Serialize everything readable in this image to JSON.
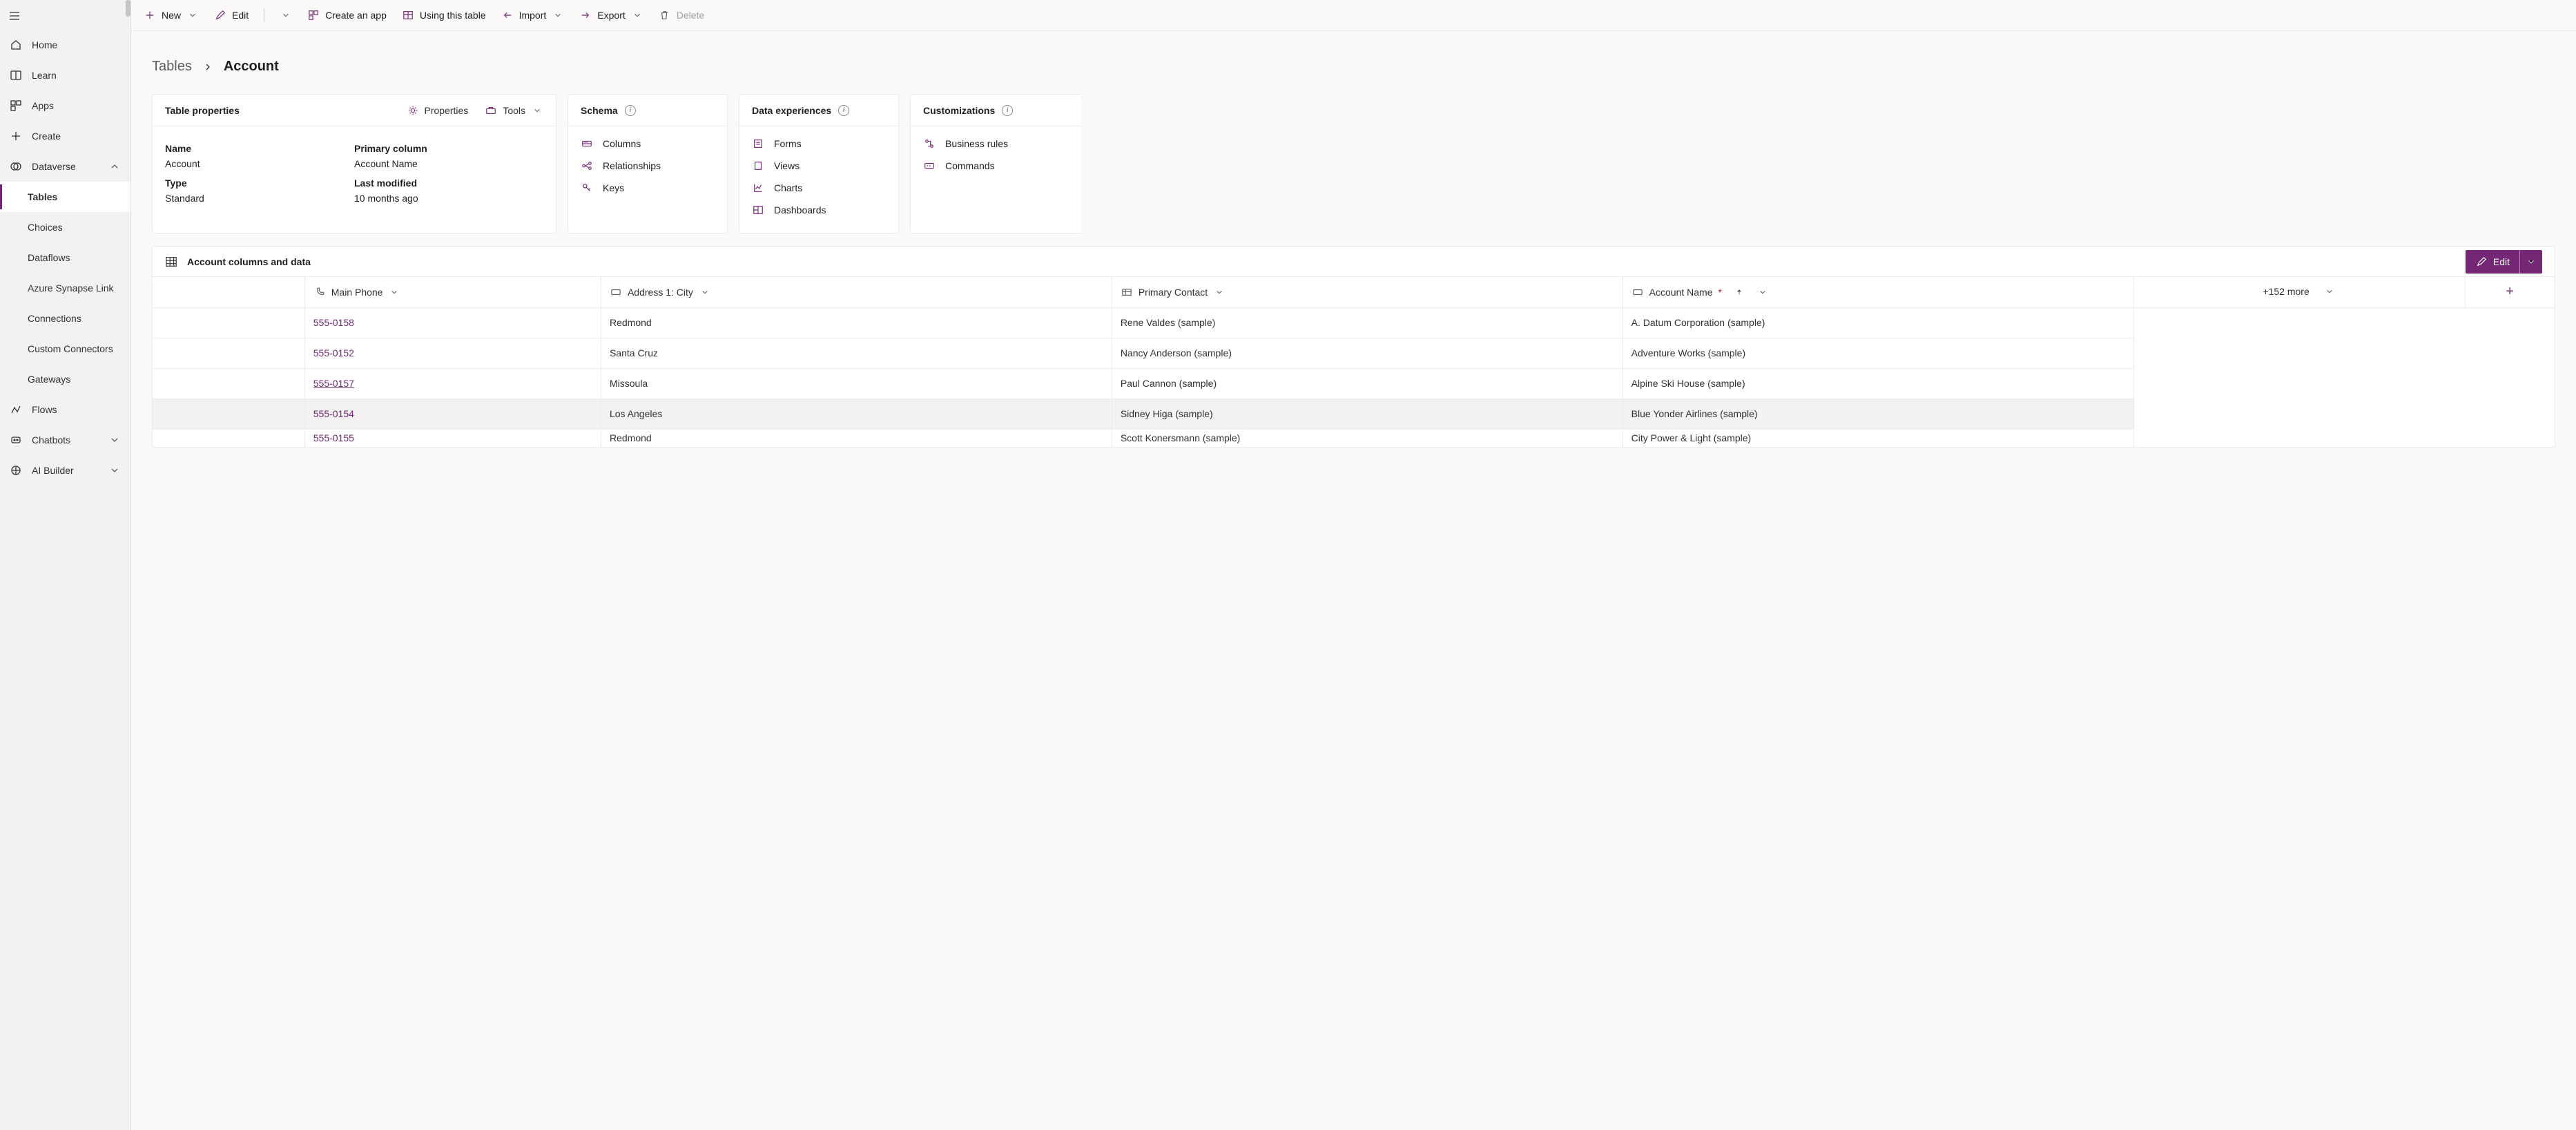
{
  "sidebar": {
    "items": [
      {
        "label": "Home"
      },
      {
        "label": "Learn"
      },
      {
        "label": "Apps"
      },
      {
        "label": "Create"
      },
      {
        "label": "Dataverse"
      }
    ],
    "dataverse_children": [
      {
        "label": "Tables",
        "active": true
      },
      {
        "label": "Choices"
      },
      {
        "label": "Dataflows"
      },
      {
        "label": "Azure Synapse Link"
      },
      {
        "label": "Connections"
      },
      {
        "label": "Custom Connectors"
      },
      {
        "label": "Gateways"
      }
    ],
    "bottom": [
      {
        "label": "Flows"
      },
      {
        "label": "Chatbots"
      },
      {
        "label": "AI Builder"
      }
    ]
  },
  "cmdbar": {
    "new": "New",
    "edit": "Edit",
    "create_app": "Create an app",
    "using_table": "Using this table",
    "import": "Import",
    "export": "Export",
    "delete": "Delete"
  },
  "breadcrumb": {
    "parent": "Tables",
    "current": "Account"
  },
  "table_properties": {
    "title": "Table properties",
    "actions": {
      "properties": "Properties",
      "tools": "Tools"
    },
    "name_label": "Name",
    "name_value": "Account",
    "type_label": "Type",
    "type_value": "Standard",
    "primary_label": "Primary column",
    "primary_value": "Account Name",
    "modified_label": "Last modified",
    "modified_value": "10 months ago"
  },
  "schema": {
    "title": "Schema",
    "items": [
      "Columns",
      "Relationships",
      "Keys"
    ]
  },
  "data_experiences": {
    "title": "Data experiences",
    "items": [
      "Forms",
      "Views",
      "Charts",
      "Dashboards"
    ]
  },
  "customizations": {
    "title": "Customizations",
    "items": [
      "Business rules",
      "Commands"
    ]
  },
  "grid": {
    "title": "Account columns and data",
    "edit": "Edit",
    "more": "+152 more",
    "columns": {
      "phone": "Main Phone",
      "city": "Address 1: City",
      "contact": "Primary Contact",
      "account": "Account Name"
    },
    "rows": [
      {
        "phone": "555-0158",
        "city": "Redmond",
        "contact": "Rene Valdes (sample)",
        "account": "A. Datum Corporation (sample)"
      },
      {
        "phone": "555-0152",
        "city": "Santa Cruz",
        "contact": "Nancy Anderson (sample)",
        "account": "Adventure Works (sample)"
      },
      {
        "phone": "555-0157",
        "city": "Missoula",
        "contact": "Paul Cannon (sample)",
        "account": "Alpine Ski House (sample)"
      },
      {
        "phone": "555-0154",
        "city": "Los Angeles",
        "contact": "Sidney Higa (sample)",
        "account": "Blue Yonder Airlines (sample)"
      },
      {
        "phone": "555-0155",
        "city": "Redmond",
        "contact": "Scott Konersmann (sample)",
        "account": "City Power & Light (sample)"
      }
    ]
  }
}
